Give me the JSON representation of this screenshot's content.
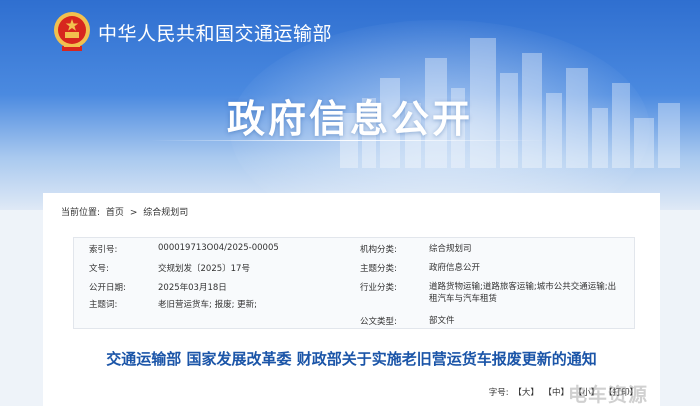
{
  "header": {
    "site_title": "中华人民共和国交通运输部",
    "banner_title": "政府信息公开"
  },
  "breadcrumb": {
    "prefix": "当前位置:",
    "home": "首页",
    "sep": ">",
    "current": "综合规划司"
  },
  "meta": {
    "index_label": "索引号:",
    "index_value": "000019713O04/2025-00005",
    "org_label": "机构分类:",
    "org_value": "综合规划司",
    "docno_label": "文号:",
    "docno_value": "交规划发〔2025〕17号",
    "topic_label": "主题分类:",
    "topic_value": "政府信息公开",
    "date_label": "公开日期:",
    "date_value": "2025年03月18日",
    "industry_label": "行业分类:",
    "industry_value_line1": "道路货物运输;道路旅客运输;城市公共交通运输;出",
    "industry_value_line2": "租汽车与汽车租赁",
    "keywords_label": "主题词:",
    "keywords_value": "老旧营运货车; 报废; 更新;",
    "doctype_label": "公文类型:",
    "doctype_value": "部文件"
  },
  "document": {
    "title": "交通运输部 国家发展改革委 财政部关于实施老旧营运货车报废更新的通知"
  },
  "font_size": {
    "prefix": "字号:",
    "large": "【大】",
    "medium": "【中】",
    "small": "【小】",
    "print": "【打印】"
  },
  "watermark": "电车资源",
  "colors": {
    "hero_blue": "#2f6fd0",
    "title_blue": "#1b55a8",
    "emblem_red": "#d7261e",
    "emblem_gold": "#f2c14e"
  },
  "icons": {
    "logo": "national-emblem-icon"
  }
}
